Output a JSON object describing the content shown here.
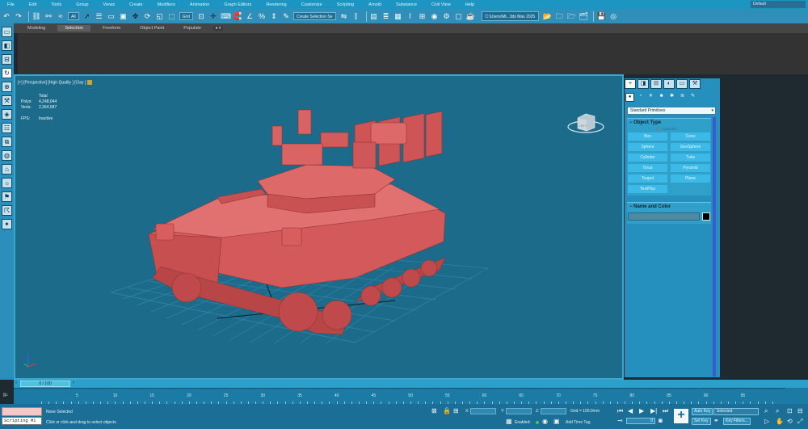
{
  "menu": [
    "File",
    "Edit",
    "Tools",
    "Group",
    "Views",
    "Create",
    "Modifiers",
    "Animation",
    "Graph Editors",
    "Rendering",
    "Customize",
    "Scripting",
    "Arnold",
    "Substance",
    "Civil View",
    "Help"
  ],
  "workspace": "Default",
  "toolbar": {
    "selection_filter": "All",
    "ref_coord": "Grid",
    "named_selection": "Create Selection Se",
    "project_path": "C:\\Users\\Mi...3ds Max 2025"
  },
  "ribbon": {
    "tabs": [
      "Modeling",
      "Selection",
      "Freeform",
      "Object Paint",
      "Populate"
    ],
    "selected_tab": "Selection"
  },
  "viewport": {
    "label": "[+] [Perspective] [High Quality ] [Clay ]",
    "stats": {
      "total_label": "Total",
      "polys_label": "Polys:",
      "polys_value": "4,248,044",
      "verts_label": "Verts:",
      "verts_value": "2,364,587",
      "fps_label": "FPS:",
      "fps_value": "Inactive"
    },
    "viewcube_face": "LEFT",
    "axis_labels": [
      "z",
      "x"
    ]
  },
  "command_panel": {
    "category": "Standard Primitives",
    "object_type_title": "Object Type",
    "autogrid": "AutoGrid",
    "objects": [
      "Box",
      "Cone",
      "Sphere",
      "GeoSphere",
      "Cylinder",
      "Tube",
      "Torus",
      "Pyramid",
      "Teapot",
      "Plane",
      "TextPlus"
    ],
    "name_color_title": "Name and Color"
  },
  "time": {
    "slider": "0 / 100",
    "ticks": [
      "5",
      "10",
      "15",
      "20",
      "25",
      "30",
      "35",
      "40",
      "45",
      "50",
      "55",
      "60",
      "65",
      "70",
      "75",
      "80",
      "85",
      "90",
      "95"
    ]
  },
  "status": {
    "script_label": "Scripting Mi",
    "selection": "None Selected",
    "prompt": "Click or click-and-drag to select objects",
    "x_label": "X:",
    "y_label": "Y:",
    "z_label": "Z:",
    "grid": "Grid = 100.0mm",
    "enabled": "Enabled:",
    "add_time_tag": "Add Time Tag",
    "auto_key": "Auto Key",
    "set_key": "Set Key",
    "selected": "Selected",
    "key_filters": "Key Filters...",
    "current_frame": "0"
  },
  "colors": {
    "accent": "#1d95c3",
    "viewport_bg": "#1d6b8b",
    "model": "#d9605f",
    "panel": "#2590be"
  }
}
